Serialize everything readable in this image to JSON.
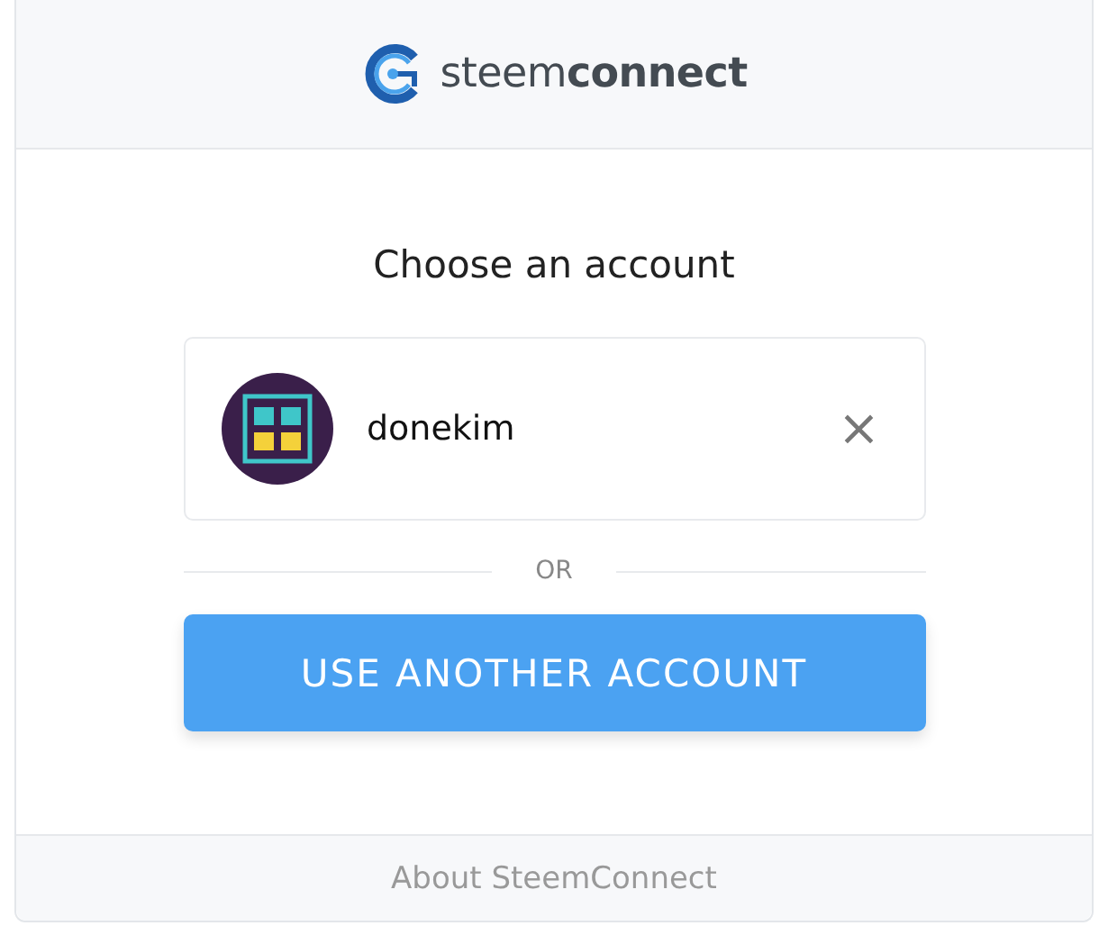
{
  "header": {
    "logo_text": "steem**connect**"
  },
  "title": "Choose an account",
  "accounts": [
    {
      "name": "donekim",
      "remove": "×"
    }
  ],
  "divider": "OR",
  "button": "USE ANOTHER ACCOUNT",
  "footer": {
    "link": "About SteemConnect"
  }
}
